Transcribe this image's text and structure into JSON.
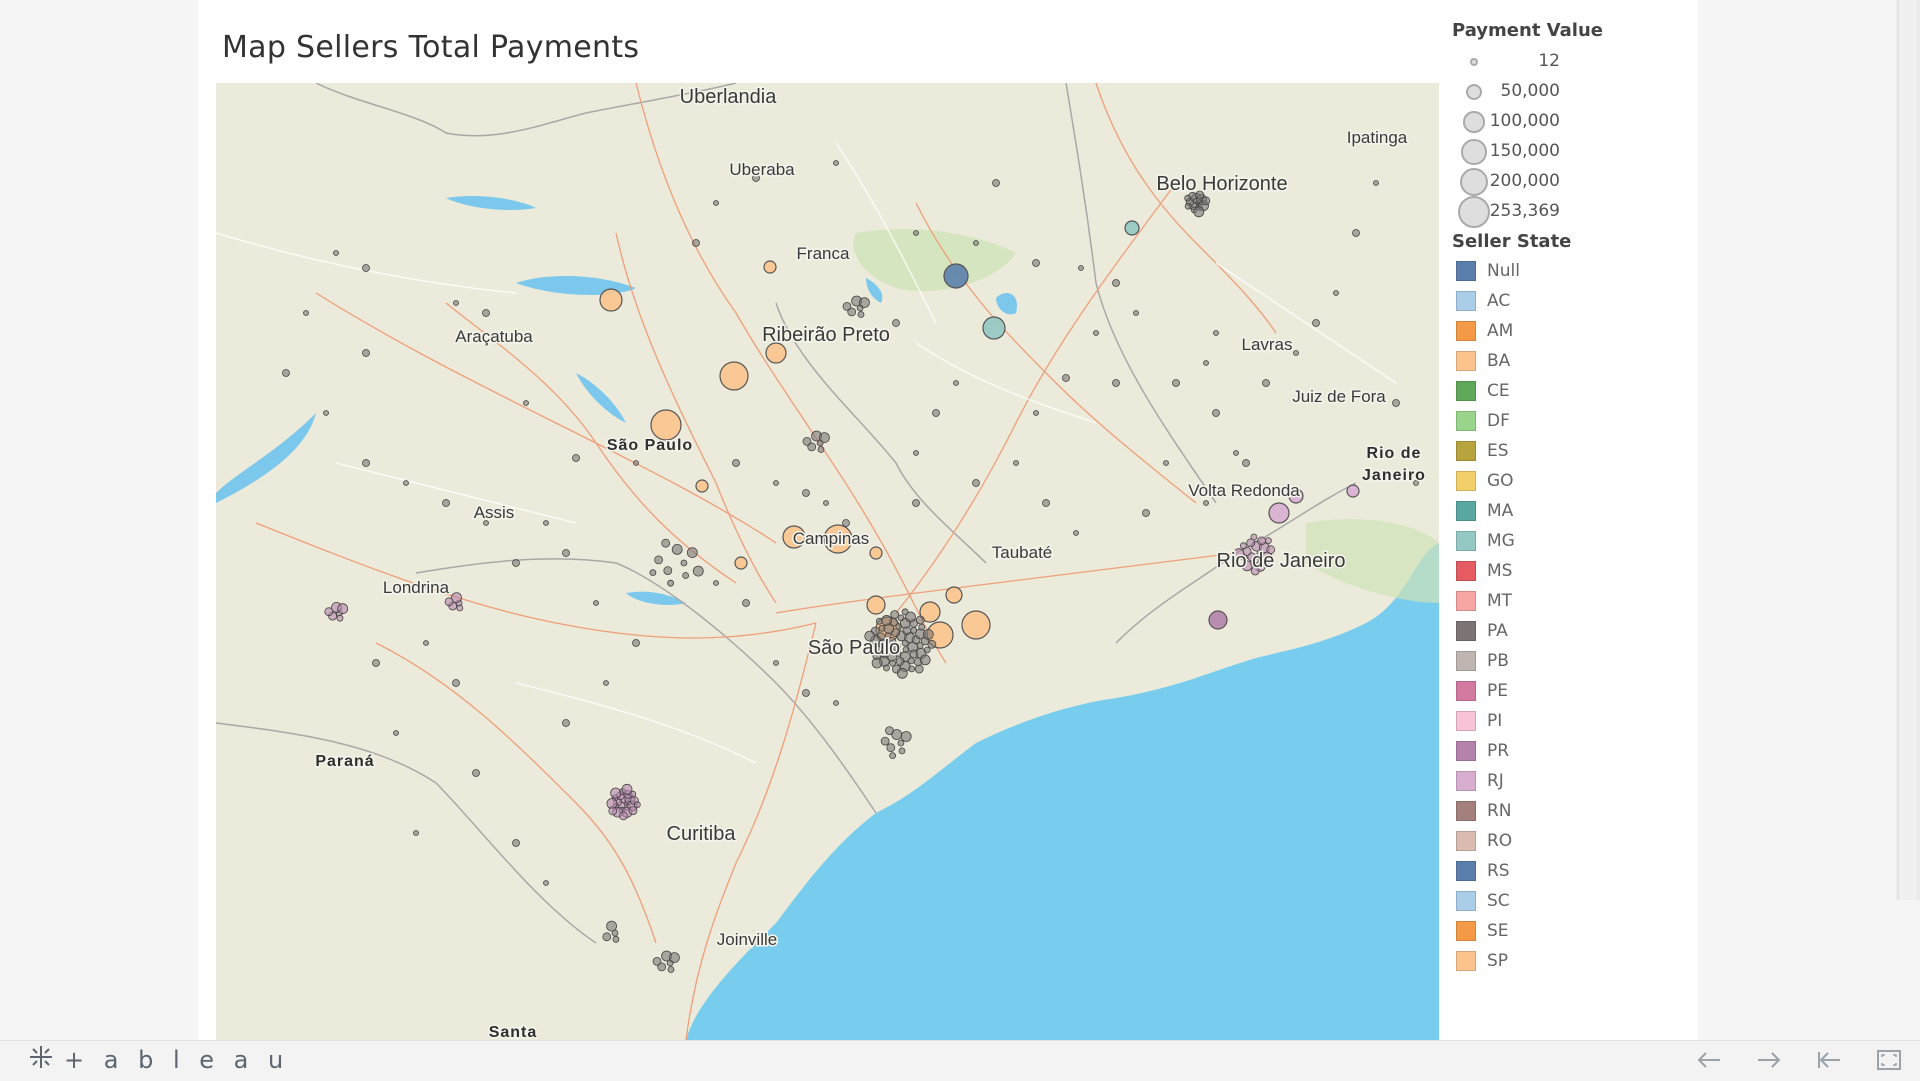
{
  "title": "Map Sellers Total Payments",
  "map_labels": [
    {
      "text": "Uberlandia",
      "cls": "city"
    },
    {
      "text": "Uberaba",
      "cls": "small"
    },
    {
      "text": "Franca",
      "cls": "small"
    },
    {
      "text": "Ribeirão Preto",
      "cls": "city"
    },
    {
      "text": "Araçatuba",
      "cls": "small"
    },
    {
      "text": "São Paulo",
      "cls": "region"
    },
    {
      "text": "Assis",
      "cls": "small"
    },
    {
      "text": "Londrina",
      "cls": "small"
    },
    {
      "text": "Paraná",
      "cls": "region"
    },
    {
      "text": "Curitiba",
      "cls": "city"
    },
    {
      "text": "Joinville",
      "cls": "small"
    },
    {
      "text": "Santa",
      "cls": "region"
    },
    {
      "text": "Campinas",
      "cls": "small"
    },
    {
      "text": "São Paulo",
      "cls": "city"
    },
    {
      "text": "Taubaté",
      "cls": "small"
    },
    {
      "text": "Belo Horizonte",
      "cls": "city"
    },
    {
      "text": "Ipatinga",
      "cls": "small"
    },
    {
      "text": "Lavras",
      "cls": "small"
    },
    {
      "text": "Juiz de Fora",
      "cls": "small"
    },
    {
      "text": "Volta Redonda",
      "cls": "small"
    },
    {
      "text": "Rio de Janeiro",
      "cls": "city"
    },
    {
      "text": "Rio de",
      "cls": "region"
    },
    {
      "text": "Janeiro",
      "cls": "region"
    }
  ],
  "legend_size": {
    "title": "Payment Value",
    "items": [
      {
        "label": "12",
        "value": 12
      },
      {
        "label": "50,000",
        "value": 50000
      },
      {
        "label": "100,000",
        "value": 100000
      },
      {
        "label": "150,000",
        "value": 150000
      },
      {
        "label": "200,000",
        "value": 200000
      },
      {
        "label": "253,369",
        "value": 253369
      }
    ]
  },
  "legend_color": {
    "title": "Seller State",
    "items": [
      {
        "label": "Null",
        "color": "#5b7fad"
      },
      {
        "label": "AC",
        "color": "#aacde8"
      },
      {
        "label": "AM",
        "color": "#f49a46"
      },
      {
        "label": "BA",
        "color": "#fbc48c"
      },
      {
        "label": "CE",
        "color": "#5fa85a"
      },
      {
        "label": "DF",
        "color": "#98d48a"
      },
      {
        "label": "ES",
        "color": "#b8a43e"
      },
      {
        "label": "GO",
        "color": "#f2cf68"
      },
      {
        "label": "MA",
        "color": "#5aa6a0"
      },
      {
        "label": "MG",
        "color": "#94c8c2"
      },
      {
        "label": "MS",
        "color": "#e45c62"
      },
      {
        "label": "MT",
        "color": "#f7a6a4"
      },
      {
        "label": "PA",
        "color": "#7c7574"
      },
      {
        "label": "PB",
        "color": "#bfb6b1"
      },
      {
        "label": "PE",
        "color": "#d47aa0"
      },
      {
        "label": "PI",
        "color": "#f8c3d8"
      },
      {
        "label": "PR",
        "color": "#b483ab"
      },
      {
        "label": "RJ",
        "color": "#d8aed0"
      },
      {
        "label": "RN",
        "color": "#a3807b"
      },
      {
        "label": "RO",
        "color": "#d9bbb0"
      },
      {
        "label": "RS",
        "color": "#5b7fad"
      },
      {
        "label": "SC",
        "color": "#aacde8"
      },
      {
        "label": "SE",
        "color": "#f49a46"
      },
      {
        "label": "SP",
        "color": "#fbc48c"
      }
    ]
  },
  "brand": "+ a b l e a u"
}
